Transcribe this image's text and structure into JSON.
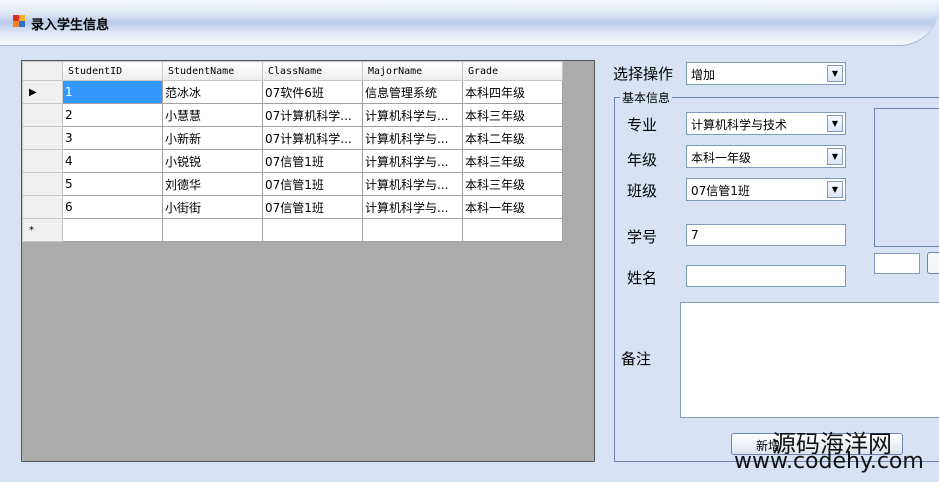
{
  "window": {
    "title": "录入学生信息"
  },
  "grid": {
    "columns": [
      "StudentID",
      "StudentName",
      "ClassName",
      "MajorName",
      "Grade"
    ],
    "rows": [
      [
        "1",
        "范冰冰",
        "07软件6班",
        "信息管理系统",
        "本科四年级"
      ],
      [
        "2",
        "小慧慧",
        "07计算机科学...",
        "计算机科学与...",
        "本科三年级"
      ],
      [
        "3",
        "小新新",
        "07计算机科学...",
        "计算机科学与...",
        "本科二年级"
      ],
      [
        "4",
        "小锐锐",
        "07信管1班",
        "计算机科学与...",
        "本科三年级"
      ],
      [
        "5",
        "刘德华",
        "07信管1班",
        "计算机科学与...",
        "本科三年级"
      ],
      [
        "6",
        "小街街",
        "07信管1班",
        "计算机科学与...",
        "本科一年级"
      ]
    ],
    "current_marker": "▶",
    "new_row_marker": "*"
  },
  "form": {
    "operation_label": "选择操作",
    "operation_value": "增加",
    "group_title": "基本信息",
    "major_label": "专业",
    "major_value": "计算机科学与技术",
    "grade_label": "年级",
    "grade_value": "本科一年级",
    "class_label": "班级",
    "class_value": "07信管1班",
    "id_label": "学号",
    "id_value": "7",
    "name_label": "姓名",
    "name_value": "",
    "note_label": "备注",
    "note_value": "",
    "submit_label": "新增"
  },
  "watermark": {
    "line1": "源码海洋网",
    "line2": "www.codehy.com"
  }
}
